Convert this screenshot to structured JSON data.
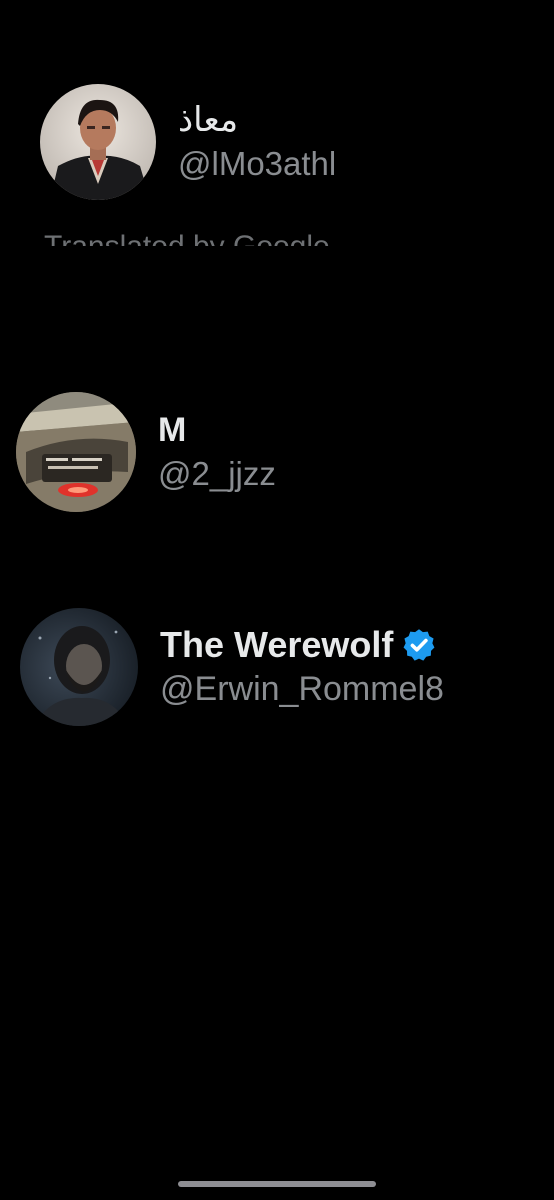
{
  "users": [
    {
      "display_name": "معاذ",
      "handle": "@lMo3athl",
      "avatar": "man-in-suit-portrait-avatar",
      "verified": false
    },
    {
      "display_name": "M",
      "handle": "@2_jjzz",
      "avatar": "car-dashboard-photo-avatar",
      "verified": false
    },
    {
      "display_name": "The Werewolf",
      "handle": "@Erwin_Rommel8",
      "avatar": "dark-bearded-man-portrait-avatar",
      "verified": true
    }
  ],
  "partial_text": "Translated by Google",
  "colors": {
    "background": "#000000",
    "name_text": "#e7e9ea",
    "handle_text": "#8a8d91",
    "verified_badge": "#1d9bf0"
  },
  "icons": {
    "verified": "verified-badge-icon"
  }
}
